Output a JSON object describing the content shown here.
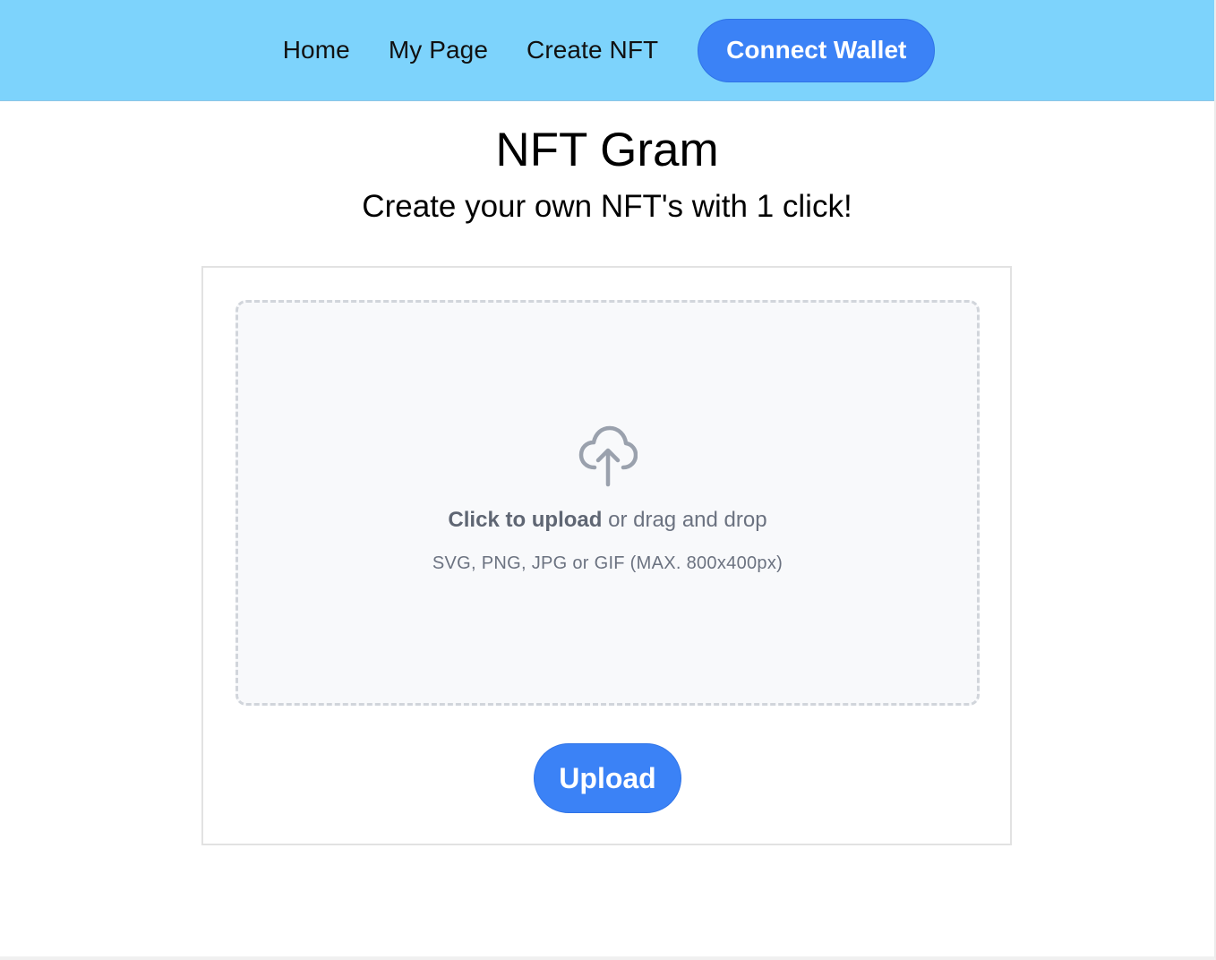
{
  "nav": {
    "items": [
      {
        "label": "Home"
      },
      {
        "label": "My Page"
      },
      {
        "label": "Create NFT"
      }
    ],
    "connect_label": "Connect Wallet"
  },
  "header": {
    "title": "NFT Gram",
    "subtitle": "Create your own NFT's with 1 click!"
  },
  "dropzone": {
    "icon": "cloud-upload-icon",
    "click_text": "Click to upload",
    "drag_text": " or drag and drop",
    "hint": "SVG, PNG, JPG or GIF (MAX. 800x400px)"
  },
  "upload_label": "Upload",
  "colors": {
    "navbar": "#7dd3fc",
    "accent": "#3b82f6",
    "dropzone_bg": "#f8f9fb",
    "muted_text": "#6b7280"
  }
}
